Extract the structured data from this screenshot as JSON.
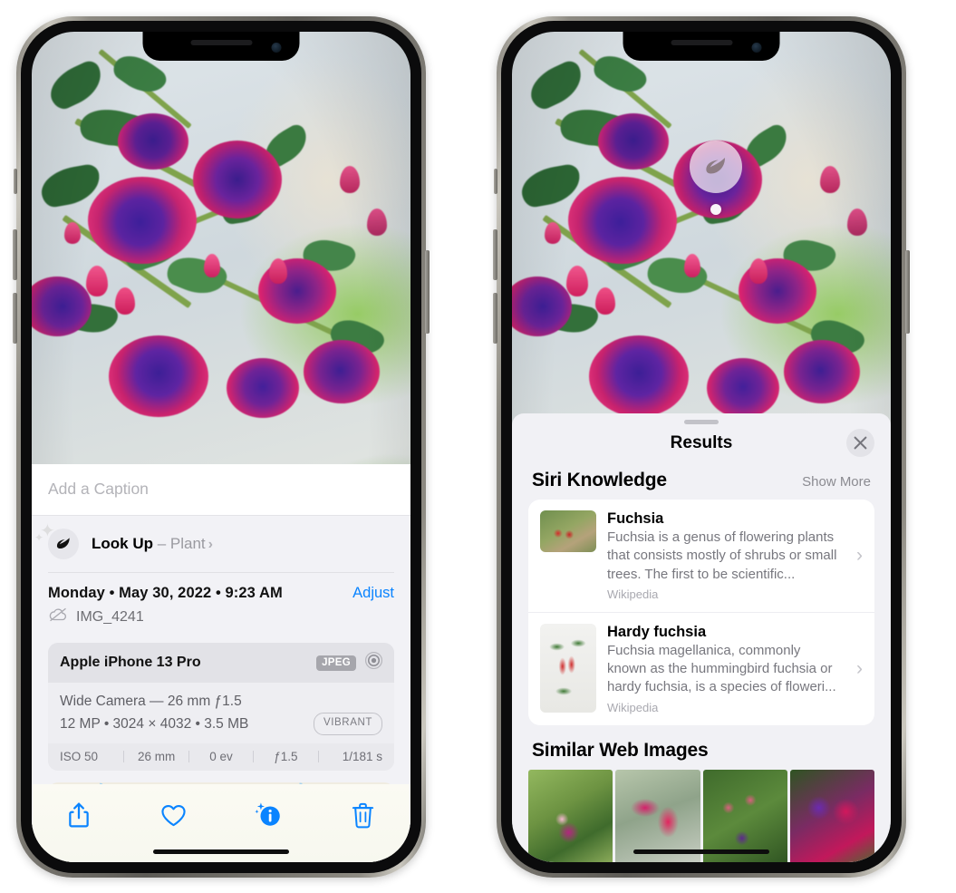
{
  "left_phone": {
    "name": "photos-detail-view",
    "caption": {
      "placeholder": "Add a Caption",
      "value": ""
    },
    "look_up": {
      "icon": "leaf-icon",
      "label": "Look Up",
      "separator": " – ",
      "subject": "Plant",
      "chevron": "›"
    },
    "meta": {
      "date_line": "Monday • May 30, 2022 • 9:23 AM",
      "adjust_label": "Adjust",
      "cloud_icon": "icloud-slash-icon",
      "filename": "IMG_4241"
    },
    "camera_card": {
      "model": "Apple iPhone 13 Pro",
      "format_badge": "JPEG",
      "lens_icon": "aperture-icon",
      "lens_line": "Wide Camera — 26 mm ƒ1.5",
      "specs_line": "12 MP  •  3024 × 4032  •  3.5 MB",
      "quality_badge": "VIBRANT",
      "exif": [
        "ISO 50",
        "26 mm",
        "0 ev",
        "ƒ1.5",
        "1/181 s"
      ]
    },
    "map": {
      "name": "location-map",
      "pin": "photo-pin"
    },
    "toolbar": [
      {
        "name": "share-button",
        "icon": "share-icon"
      },
      {
        "name": "favorite-button",
        "icon": "heart-icon"
      },
      {
        "name": "info-button",
        "icon": "info-sparkle-icon"
      },
      {
        "name": "delete-button",
        "icon": "trash-icon"
      }
    ],
    "accent_color": "#0a84ff"
  },
  "right_phone": {
    "name": "visual-look-up-results",
    "chip": {
      "icon": "leaf-icon",
      "name": "visual-lookup-chip"
    },
    "sheet": {
      "title": "Results",
      "close_icon": "close-icon",
      "siri_section": {
        "title": "Siri Knowledge",
        "show_more": "Show More",
        "items": [
          {
            "title": "Fuchsia",
            "description": "Fuchsia is a genus of flowering plants that consists mostly of shrubs or small trees. The first to be scientific...",
            "source": "Wikipedia",
            "thumb": "fuchsia-thumbnail"
          },
          {
            "title": "Hardy fuchsia",
            "description": "Fuchsia magellanica, commonly known as the hummingbird fuchsia or hardy fuchsia, is a species of floweri...",
            "source": "Wikipedia",
            "thumb": "hardy-fuchsia-thumbnail"
          }
        ]
      },
      "web_section": {
        "title": "Similar Web Images",
        "tiles": [
          "web-image-1",
          "web-image-2",
          "web-image-3",
          "web-image-4"
        ]
      }
    }
  }
}
